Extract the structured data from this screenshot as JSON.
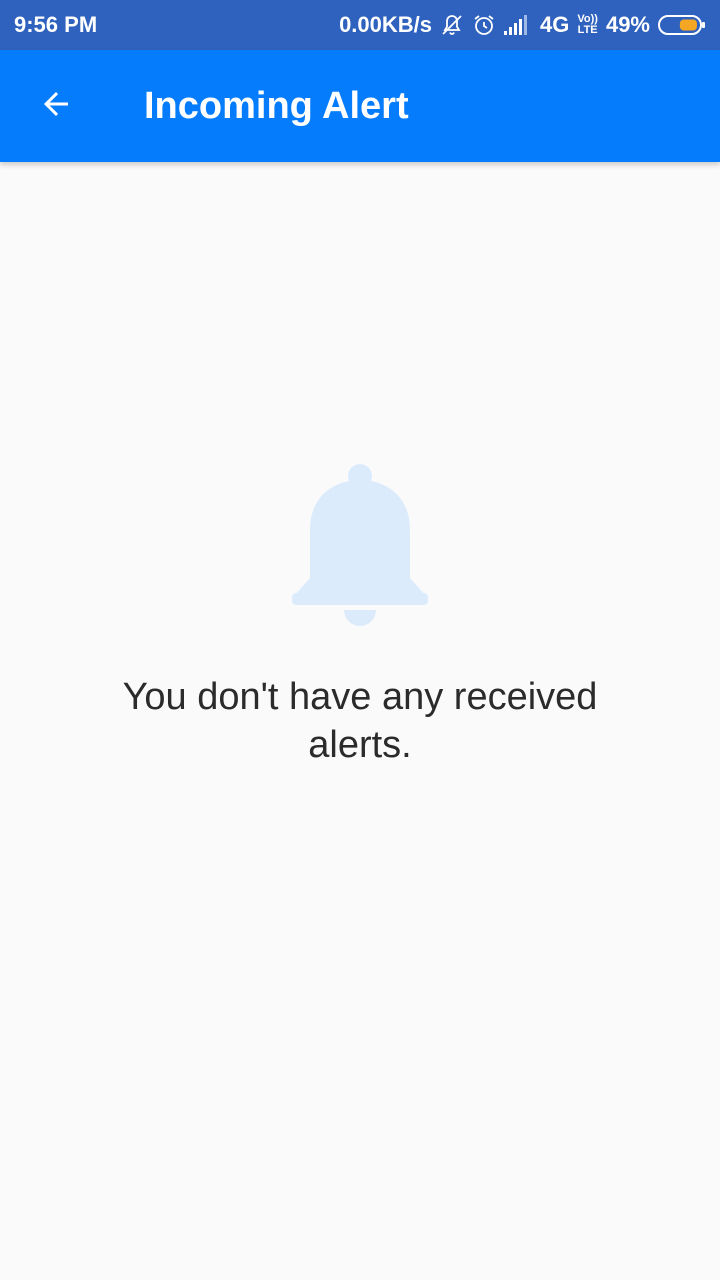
{
  "status_bar": {
    "time": "9:56 PM",
    "network_speed": "0.00KB/s",
    "network_type": "4G",
    "volte_label_top": "Vo))",
    "volte_label_bottom": "LTE",
    "battery_percent": "49%",
    "battery_level": 0.49,
    "icons": [
      "notifications-off-icon",
      "alarm-icon",
      "signal-icon",
      "volte-icon",
      "battery-icon"
    ]
  },
  "app_bar": {
    "title": "Incoming Alert",
    "back_icon": "back-arrow-icon"
  },
  "empty_state": {
    "icon": "bell-icon",
    "message": "You don't have any received alerts."
  },
  "colors": {
    "status_bar_bg": "#2f62be",
    "app_bar_bg": "#047cfc",
    "page_bg": "#fafafa",
    "bell_color": "#dcebfb",
    "text_color": "#2b2b2b",
    "battery_fill": "#f5a623"
  }
}
